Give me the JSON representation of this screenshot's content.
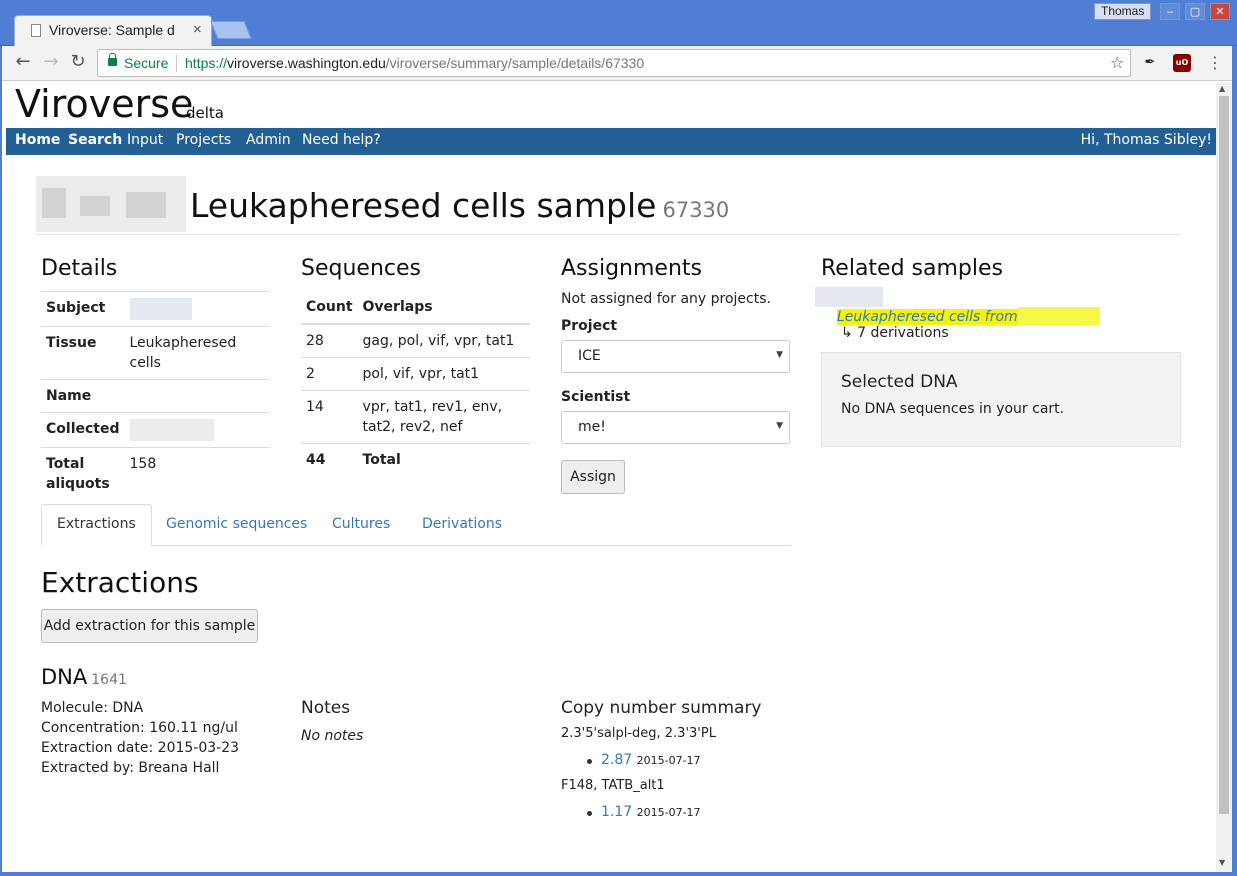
{
  "browser": {
    "tab_title": "Viroverse: Sample d",
    "tab_close": "×",
    "window_user": "Thomas",
    "secure_label": "Secure",
    "url_scheme": "https://",
    "url_host": "viroverse.washington.edu",
    "url_path": "/viroverse/summary/sample/details/67330",
    "window_buttons": [
      "‒",
      "▢",
      "✕"
    ]
  },
  "app": {
    "brand": "Viroverse",
    "brand_sub": "delta"
  },
  "nav": {
    "items": [
      "Home",
      "Search",
      "Input",
      "Projects",
      "Admin",
      "Need help?"
    ],
    "greeting": "Hi, Thomas Sibley!"
  },
  "page": {
    "title": "Leukapheresed cells sample",
    "id": "67330"
  },
  "details": {
    "heading": "Details",
    "rows": [
      {
        "label": "Subject",
        "value": ""
      },
      {
        "label": "Tissue",
        "value": "Leukapheresed cells"
      },
      {
        "label": "Name",
        "value": ""
      },
      {
        "label": "Collected",
        "value": ""
      },
      {
        "label": "Total aliquots",
        "value": "158"
      }
    ]
  },
  "sequences": {
    "heading": "Sequences",
    "col_count": "Count",
    "col_overlaps": "Overlaps",
    "rows": [
      {
        "count": "28",
        "overlaps": "gag, pol, vif, vpr, tat1"
      },
      {
        "count": "2",
        "overlaps": "pol, vif, vpr, tat1"
      },
      {
        "count": "14",
        "overlaps": "vpr, tat1, rev1, env, tat2, rev2, nef"
      }
    ],
    "total_count": "44",
    "total_label": "Total"
  },
  "assignments": {
    "heading": "Assignments",
    "status": "Not assigned for any projects.",
    "project_label": "Project",
    "project_value": "ICE",
    "scientist_label": "Scientist",
    "scientist_value": "me!",
    "assign_button": "Assign"
  },
  "related": {
    "heading": "Related samples",
    "link_text": "Leukapheresed cells from",
    "derivations": "↳ 7 derivations"
  },
  "selected_dna": {
    "heading": "Selected DNA",
    "message": "No DNA sequences in your cart."
  },
  "tabs": [
    "Extractions",
    "Genomic sequences",
    "Cultures",
    "Derivations"
  ],
  "extractions": {
    "heading": "Extractions",
    "add_button": "Add extraction for this sample",
    "dna_label": "DNA",
    "dna_id": "1641",
    "molecule": "Molecule:  DNA",
    "concentration": "Concentration:  160.11 ng/ul",
    "extraction_date": "Extraction date:  2015-03-23",
    "extracted_by": "Extracted by:  Breana Hall",
    "notes_heading": "Notes",
    "notes_value": "No notes",
    "copy_heading": "Copy number summary",
    "copy_groups": [
      {
        "primers": "2.3'5'salpl-deg, 2.3'3'PL",
        "value": "2.87",
        "date": "2015-07-17"
      },
      {
        "primers": "F148, TATB_alt1",
        "value": "1.17",
        "date": "2015-07-17"
      }
    ]
  }
}
